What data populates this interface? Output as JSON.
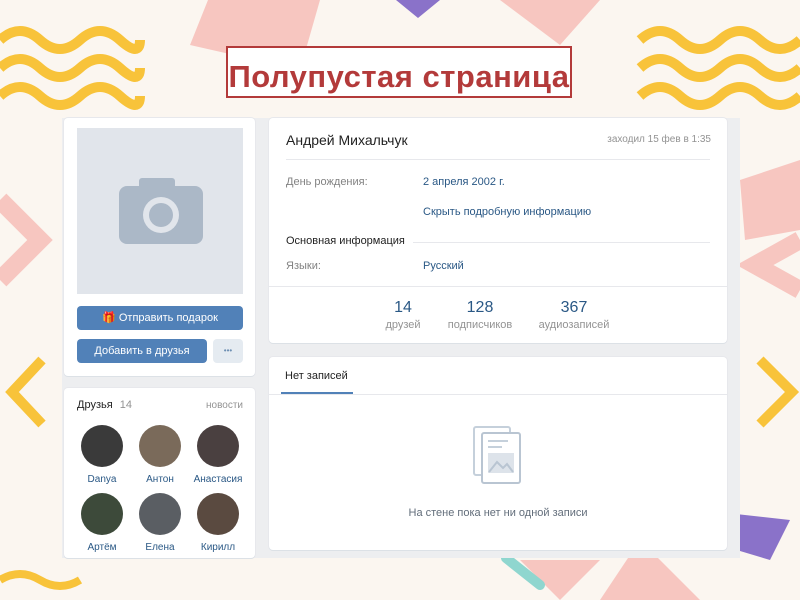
{
  "slide_title": "Полупустая страница",
  "profile": {
    "name": "Андрей Михальчук",
    "last_seen": "заходил 15 фев в 1:35",
    "birthday_label": "День рождения:",
    "birthday_value": "2 апреля 2002 г.",
    "hide_info_link": "Скрыть подробную информацию",
    "section_main_info": "Основная информация",
    "languages_label": "Языки:",
    "languages_value": "Русский"
  },
  "counters": [
    {
      "value": "14",
      "label": "друзей"
    },
    {
      "value": "128",
      "label": "подписчиков"
    },
    {
      "value": "367",
      "label": "аудиозаписей"
    }
  ],
  "actions": {
    "send_gift": "Отправить подарок",
    "add_friend": "Добавить в друзья",
    "more": "•••"
  },
  "friends_block": {
    "title": "Друзья",
    "count": "14",
    "updates_link": "новости",
    "items": [
      {
        "name": "Danya",
        "color": "#3a3a3a"
      },
      {
        "name": "Антон",
        "color": "#7a6a5a"
      },
      {
        "name": "Анастасия",
        "color": "#4a4040"
      },
      {
        "name": "Артём",
        "color": "#3d4a3a"
      },
      {
        "name": "Елена",
        "color": "#5a5e63"
      },
      {
        "name": "Кирилл",
        "color": "#5a4a40"
      }
    ]
  },
  "wall": {
    "tab_label": "Нет записей",
    "empty_text": "На стене пока нет ни одной записи"
  },
  "icons": {
    "avatar_placeholder": "camera-icon",
    "gift": "gift-icon",
    "empty_wall": "document-image-icon"
  },
  "colors": {
    "accent": "#5181b8",
    "title_red": "#b33a3a",
    "link": "#2a5885"
  }
}
